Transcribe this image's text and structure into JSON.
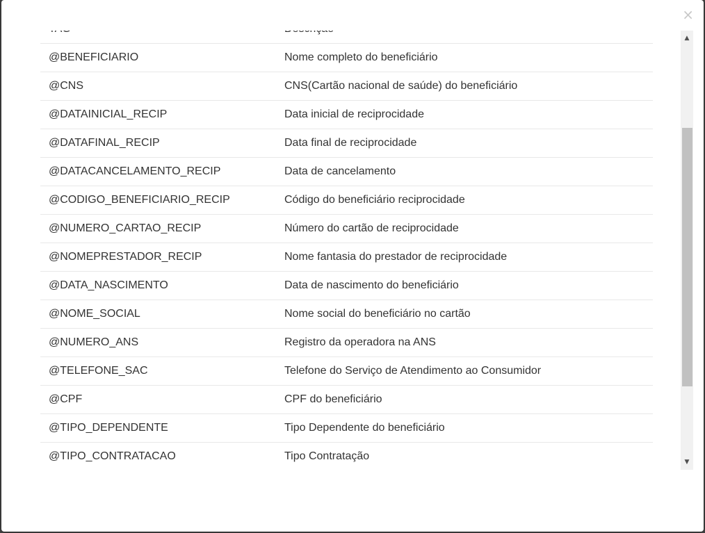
{
  "modal": {
    "close_label": "×"
  },
  "table": {
    "headers": [
      "TAG",
      "Descrição"
    ],
    "rows": [
      {
        "tag": "@BENEFICIARIO",
        "desc": "Nome completo do beneficiário"
      },
      {
        "tag": "@CNS",
        "desc": "CNS(Cartão nacional de saúde) do beneficiário"
      },
      {
        "tag": "@DATAINICIAL_RECIP",
        "desc": "Data inicial de reciprocidade"
      },
      {
        "tag": "@DATAFINAL_RECIP",
        "desc": "Data final de reciprocidade"
      },
      {
        "tag": "@DATACANCELAMENTO_RECIP",
        "desc": "Data de cancelamento"
      },
      {
        "tag": "@CODIGO_BENEFICIARIO_RECIP",
        "desc": "Código do beneficiário reciprocidade"
      },
      {
        "tag": "@NUMERO_CARTAO_RECIP",
        "desc": "Número do cartão de reciprocidade"
      },
      {
        "tag": "@NOMEPRESTADOR_RECIP",
        "desc": "Nome fantasia do prestador de reciprocidade"
      },
      {
        "tag": "@DATA_NASCIMENTO",
        "desc": "Data de nascimento do beneficiário"
      },
      {
        "tag": "@NOME_SOCIAL",
        "desc": "Nome social do beneficiário no cartão"
      },
      {
        "tag": "@NUMERO_ANS",
        "desc": "Registro da operadora na ANS"
      },
      {
        "tag": "@TELEFONE_SAC",
        "desc": "Telefone do Serviço de Atendimento ao Consumidor"
      },
      {
        "tag": "@CPF",
        "desc": "CPF do beneficiário"
      },
      {
        "tag": "@TIPO_DEPENDENTE",
        "desc": "Tipo Dependente do beneficiário"
      },
      {
        "tag": "@TIPO_CONTRATACAO",
        "desc": "Tipo Contratação"
      }
    ]
  },
  "scrollbar": {
    "up_icon": "arrow-up-icon",
    "down_icon": "arrow-down-icon"
  },
  "colors": {
    "text": "#333333",
    "row_border": "#e8e8e8",
    "scroll_track": "#f1f1f1",
    "scroll_thumb": "#c1c1c1"
  }
}
